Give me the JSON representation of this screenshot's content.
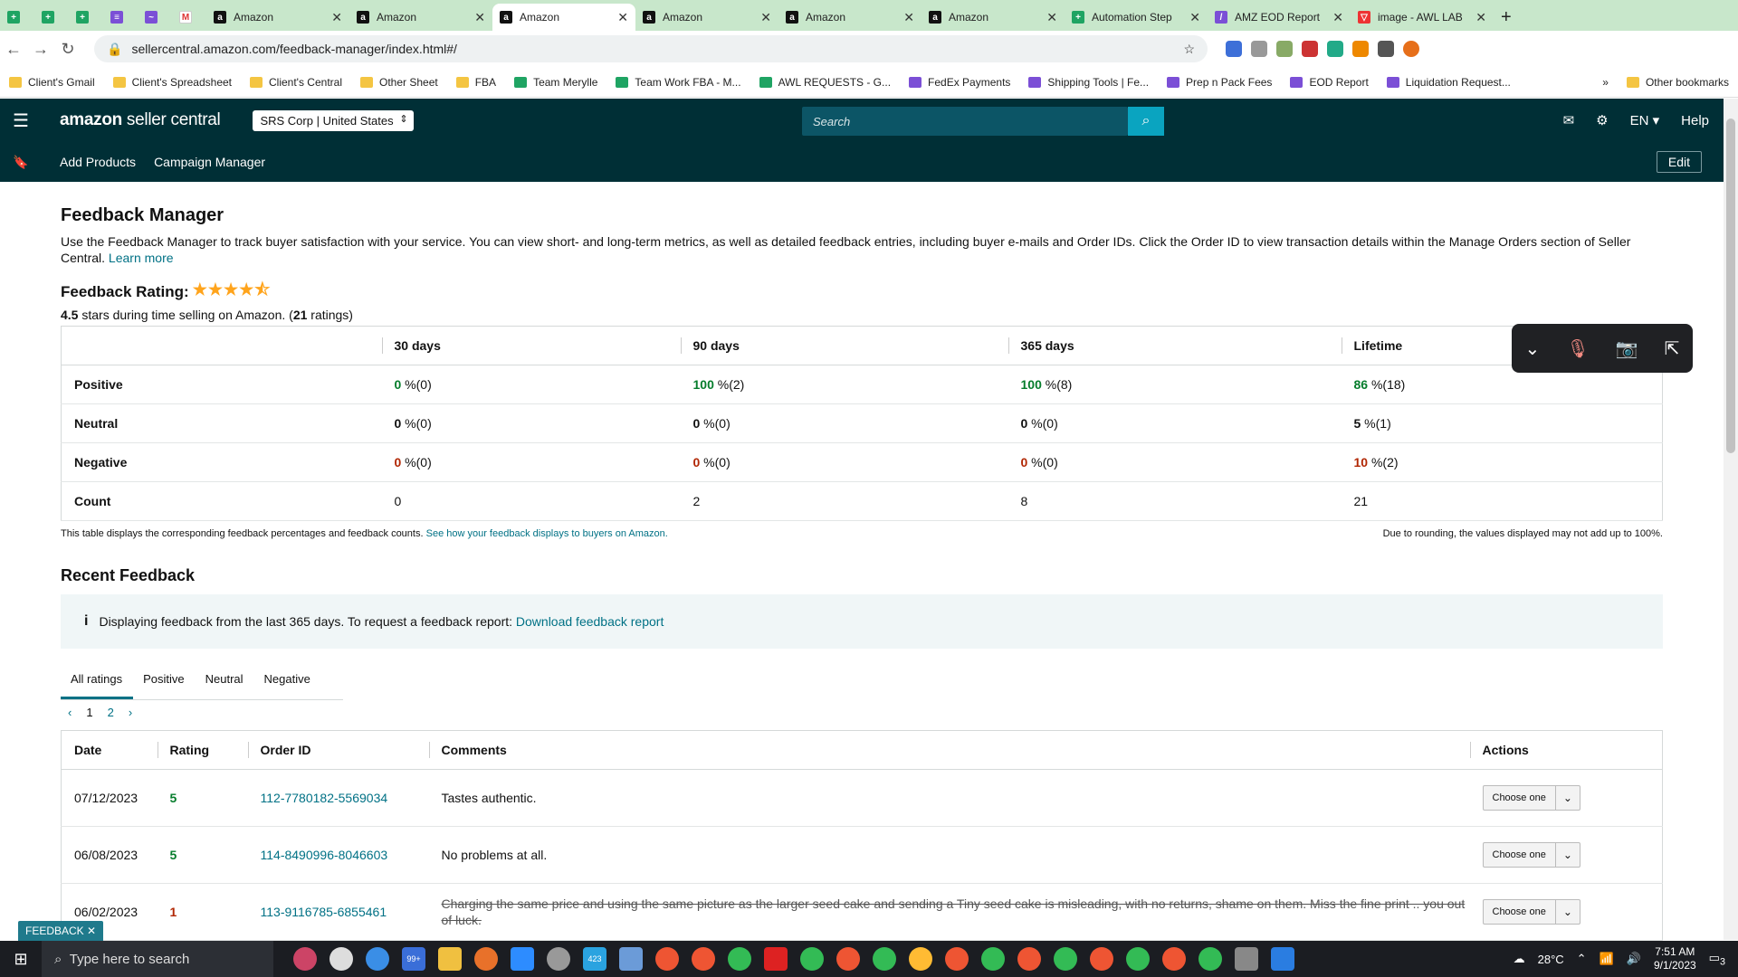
{
  "browser": {
    "tabs": [
      {
        "label": "",
        "icon": "sheets-icon",
        "kind": "pin"
      },
      {
        "label": "",
        "icon": "sheets-icon",
        "kind": "pin"
      },
      {
        "label": "",
        "icon": "sheets-icon",
        "kind": "pin"
      },
      {
        "label": "",
        "icon": "forms-icon",
        "kind": "pin"
      },
      {
        "label": "",
        "icon": "messenger-icon",
        "kind": "pin"
      },
      {
        "label": "",
        "icon": "gmail-icon",
        "kind": "pin"
      },
      {
        "label": "Amazon",
        "icon": "amazon-icon"
      },
      {
        "label": "Amazon",
        "icon": "amazon-icon"
      },
      {
        "label": "Amazon",
        "icon": "amazon-icon",
        "active": true
      },
      {
        "label": "Amazon",
        "icon": "amazon-icon"
      },
      {
        "label": "Amazon",
        "icon": "amazon-icon"
      },
      {
        "label": "Amazon",
        "icon": "amazon-icon"
      },
      {
        "label": "Automation Step",
        "icon": "sheets-icon"
      },
      {
        "label": "AMZ EOD Report",
        "icon": "report-icon"
      },
      {
        "label": "image - AWL LAB",
        "icon": "mail-icon"
      }
    ],
    "url": "sellercentral.amazon.com/feedback-manager/index.html#/",
    "bookmarks": [
      {
        "label": "Client's Gmail"
      },
      {
        "label": "Client's Spreadsheet"
      },
      {
        "label": "Client's Central"
      },
      {
        "label": "Other Sheet"
      },
      {
        "label": "FBA"
      },
      {
        "label": "Team Merylle"
      },
      {
        "label": "Team Work FBA - M..."
      },
      {
        "label": "AWL REQUESTS - G..."
      },
      {
        "label": "FedEx Payments"
      },
      {
        "label": "Shipping Tools | Fe..."
      },
      {
        "label": "Prep n Pack Fees"
      },
      {
        "label": "EOD Report"
      },
      {
        "label": "Liquidation Request..."
      }
    ],
    "bookmarks_more": "»",
    "other_bookmarks": "Other bookmarks"
  },
  "header": {
    "logo_main": "amazon",
    "logo_sub": " seller central",
    "account": "SRS Corp | United States",
    "search_placeholder": "Search",
    "language": "EN",
    "help": "Help"
  },
  "subnav": {
    "items": [
      "Add Products",
      "Campaign Manager"
    ],
    "edit": "Edit"
  },
  "page": {
    "title": "Feedback Manager",
    "description": "Use the Feedback Manager to track buyer satisfaction with your service. You can view short- and long-term metrics, as well as detailed feedback entries, including buyer e-mails and Order IDs. Click the Order ID to view transaction details within the Manage Orders section of Seller Central.",
    "learn_more": "Learn more",
    "rating_label": "Feedback Rating:",
    "stars": "★★★★⯪",
    "rating_value": "4.5",
    "rating_text": " stars during time selling on Amazon. (",
    "rating_count": "21",
    "rating_suffix": " ratings)"
  },
  "summary_table": {
    "headers": [
      "",
      "30 days",
      "90 days",
      "365 days",
      "Lifetime"
    ],
    "rows": [
      {
        "label": "Positive",
        "cells": [
          {
            "v": "0",
            "s": " %(0)"
          },
          {
            "v": "100",
            "s": " %(2)"
          },
          {
            "v": "100",
            "s": " %(8)"
          },
          {
            "v": "86",
            "s": " %(18)"
          }
        ],
        "tone": "g"
      },
      {
        "label": "Neutral",
        "cells": [
          {
            "v": "0",
            "s": " %(0)"
          },
          {
            "v": "0",
            "s": " %(0)"
          },
          {
            "v": "0",
            "s": " %(0)"
          },
          {
            "v": "5",
            "s": " %(1)"
          }
        ],
        "tone": "n"
      },
      {
        "label": "Negative",
        "cells": [
          {
            "v": "0",
            "s": " %(0)"
          },
          {
            "v": "0",
            "s": " %(0)"
          },
          {
            "v": "0",
            "s": " %(0)"
          },
          {
            "v": "10",
            "s": " %(2)"
          }
        ],
        "tone": "r"
      },
      {
        "label": "Count",
        "cells": [
          {
            "v": "",
            "s": "0"
          },
          {
            "v": "",
            "s": "2"
          },
          {
            "v": "",
            "s": "8"
          },
          {
            "v": "",
            "s": "21"
          }
        ],
        "tone": "plain"
      }
    ],
    "note_left": "This table displays the corresponding feedback percentages and feedback counts.",
    "note_link": "See how your feedback displays to buyers on Amazon.",
    "note_right": "Due to rounding, the values displayed may not add up to 100%."
  },
  "recent": {
    "title": "Recent Feedback",
    "info_text": "Displaying feedback from the last 365 days. To request a feedback report:",
    "info_link": "Download feedback report",
    "tabs": [
      "All ratings",
      "Positive",
      "Neutral",
      "Negative"
    ],
    "pages": [
      "1",
      "2"
    ],
    "headers": [
      "Date",
      "Rating",
      "Order ID",
      "Comments",
      "Actions"
    ],
    "rows": [
      {
        "date": "07/12/2023",
        "rating": "5",
        "order": "112-7780182-5569034",
        "comment": "Tastes authentic.",
        "struck": false
      },
      {
        "date": "06/08/2023",
        "rating": "5",
        "order": "114-8490996-8046603",
        "comment": "No problems at all.",
        "struck": false
      },
      {
        "date": "06/02/2023",
        "rating": "1",
        "order": "113-9116785-6855461",
        "comment": "Charging the same price and using the same picture as the larger seed cake and sending a Tiny seed cake is misleading, with no returns, shame on them. Miss the fine print .. you out of luck.",
        "struck": true
      }
    ],
    "action_label": "Choose one"
  },
  "feedback_tag": "FEEDBACK",
  "taskbar": {
    "search_placeholder": "Type here to search",
    "temperature": "28°C",
    "time": "7:51 AM",
    "date": "9/1/2023",
    "badge_mail": "99+",
    "badge_telegram": "423",
    "notif_count": "3"
  }
}
